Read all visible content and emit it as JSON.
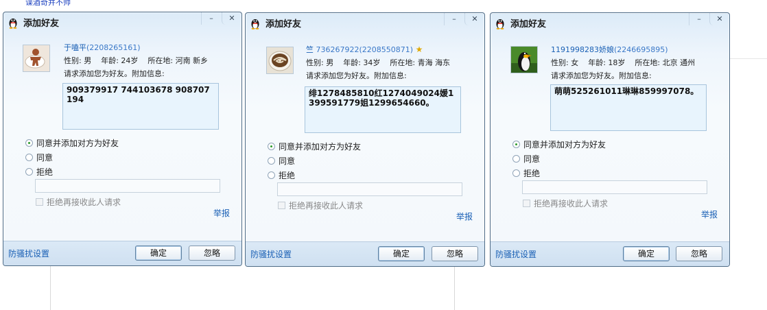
{
  "background": {
    "text": "谍酒奇并不帅"
  },
  "dialogs": [
    {
      "title": "添加好友",
      "min_glyph": "–",
      "close_glyph": "✕",
      "avatar_icon": "gingerbread-cup-avatar",
      "name": "于嗑平",
      "uid": "(2208265161)",
      "vip_star": "",
      "gender_label": "性别: 男",
      "age_label": "年龄: 24岁",
      "location_label": "所在地: 河南 新乡",
      "request_text": "请求添加您为好友。附加信息:",
      "message": "909379917  744103678 908707194",
      "options": [
        "同意并添加对方为好友",
        "同意",
        "拒绝"
      ],
      "selected_option": 0,
      "reject_check_label": "拒绝再接收此人请求",
      "report_label": "举报",
      "antispam_label": "防骚扰设置",
      "ok_label": "确定",
      "ignore_label": "忽略"
    },
    {
      "title": "添加好友",
      "min_glyph": "–",
      "close_glyph": "✕",
      "avatar_icon": "coffee-latte-avatar",
      "name": "竺",
      "uid": "736267922(2208550871)",
      "vip_star": "★",
      "gender_label": "性别: 男",
      "age_label": "年龄: 34岁",
      "location_label": "所在地: 青海 海东",
      "request_text": "请求添加您为好友。附加信息:",
      "message": "绯1278485810红1274049024媛1399591779姐1299654660。",
      "options": [
        "同意并添加对方为好友",
        "同意",
        "拒绝"
      ],
      "selected_option": 0,
      "reject_check_label": "拒绝再接收此人请求",
      "report_label": "举报",
      "antispam_label": "防骚扰设置",
      "ok_label": "确定",
      "ignore_label": "忽略"
    },
    {
      "title": "添加好友",
      "min_glyph": "–",
      "close_glyph": "✕",
      "avatar_icon": "penguin-avatar",
      "name": "1191998283娇娘",
      "uid": "(2246695895)",
      "vip_star": "",
      "gender_label": "性别: 女",
      "age_label": "年龄: 18岁",
      "location_label": "所在地: 北京 通州",
      "request_text": "请求添加您为好友。附加信息:",
      "message": "萌萌525261011琳琳859997078。",
      "options": [
        "同意并添加对方为好友",
        "同意",
        "拒绝"
      ],
      "selected_option": 0,
      "reject_check_label": "拒绝再接收此人请求",
      "report_label": "举报",
      "antispam_label": "防骚扰设置",
      "ok_label": "确定",
      "ignore_label": "忽略"
    }
  ]
}
